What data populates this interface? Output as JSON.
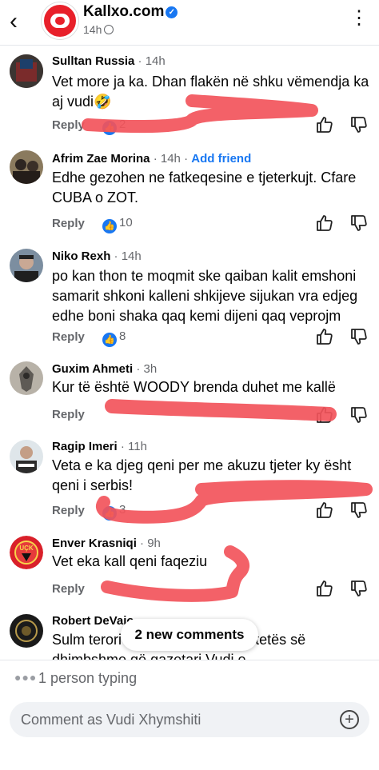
{
  "header": {
    "page_name": "Kallxo.com",
    "post_time": "14h"
  },
  "comments": [
    {
      "name": "Sulltan Russia",
      "time": "14h",
      "text": "Vet more ja ka. Dhan flakën në shku vëmendja ka aj vudi🤣",
      "reply": "Reply",
      "reactions": "2"
    },
    {
      "name": "Afrim Zae Morina",
      "time": "14h",
      "add_friend": "Add friend",
      "text": "Edhe gezohen ne fatkeqesine e tjeterkujt. Cfare CUBA o ZOT.",
      "reply": "Reply",
      "reactions": "10"
    },
    {
      "name": "Niko Rexh",
      "time": "14h",
      "text": "po kan thon te moqmit ske qaiban kalit emshoni samarit shkoni kalleni shkijeve sijukan vra edjeg edhe boni shaka qaq kemi dijeni qaq veprojm",
      "reply": "Reply",
      "reactions": "8"
    },
    {
      "name": "Guxim Ahmeti",
      "time": "3h",
      "text": "Kur të është WOODY brenda duhet me kallë",
      "reply": "Reply"
    },
    {
      "name": "Ragip Imeri",
      "time": "11h",
      "text": "Veta e ka djeg qeni per me akuzu tjeter ky ësht qeni i serbis!",
      "reply": "Reply",
      "reactions": "3"
    },
    {
      "name": "Enver Krasniqi",
      "time": "9h",
      "text": "Vet eka kall qeni faqeziu",
      "reply": "Reply"
    },
    {
      "name": "Robert DeVaio",
      "time": "",
      "text": "Sulm terori ... mafias ndaj të vërtetës së dhimbshme që gazetari Vudi e"
    }
  ],
  "new_comments_label": "2 new comments",
  "typing_indicator": "1 person typing",
  "composer": {
    "placeholder": "Comment as Vudi Xhymshiti"
  },
  "colors": {
    "accent": "#1877f2",
    "scribble": "#f2545b",
    "brand_red": "#e8202a"
  }
}
